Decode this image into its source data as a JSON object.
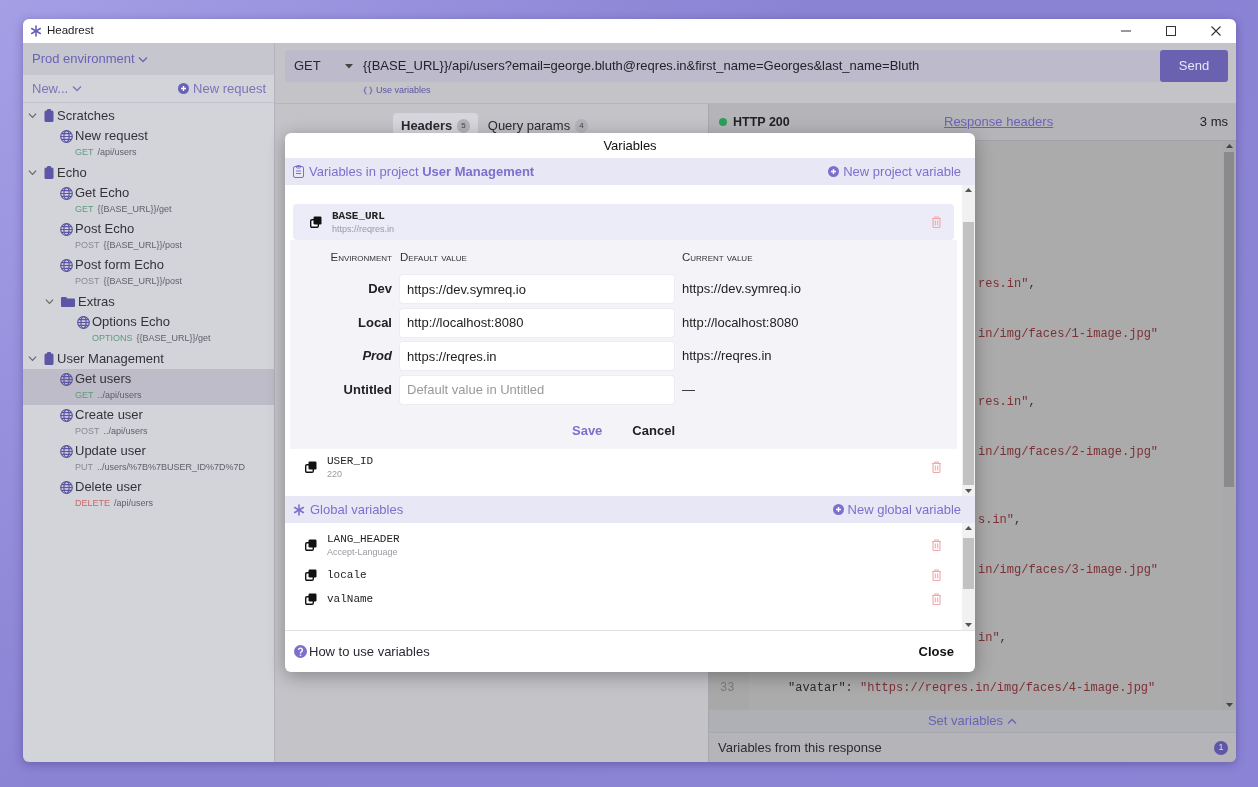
{
  "window": {
    "title": "Headrest"
  },
  "sidebar": {
    "environment": "Prod environment",
    "new_menu": "New...",
    "new_request": "New request",
    "tree": [
      {
        "kind": "project",
        "label": "Scratches",
        "expanded": true,
        "children": [
          {
            "kind": "request",
            "label": "New request",
            "method": "GET",
            "url": "/api/users",
            "color": "#5f9a7c",
            "selected": false
          }
        ]
      },
      {
        "kind": "project",
        "label": "Echo",
        "expanded": true,
        "children": [
          {
            "kind": "request",
            "label": "Get Echo",
            "method": "GET",
            "url": "{{BASE_URL}}/get",
            "color": "#5f9a7c",
            "selected": false
          },
          {
            "kind": "request",
            "label": "Post Echo",
            "method": "POST",
            "url": "{{BASE_URL}}/post",
            "color": "#8a8a93",
            "selected": false
          },
          {
            "kind": "request",
            "label": "Post form Echo",
            "method": "POST",
            "url": "{{BASE_URL}}/post",
            "color": "#8a8a93",
            "selected": false
          },
          {
            "kind": "folder",
            "label": "Extras",
            "expanded": true,
            "children": [
              {
                "kind": "request",
                "label": "Options Echo",
                "method": "OPTIONS",
                "url": "{{BASE_URL}}/get",
                "color": "#5f9a7c",
                "selected": false
              }
            ]
          }
        ]
      },
      {
        "kind": "project",
        "label": "User Management",
        "expanded": true,
        "children": [
          {
            "kind": "request",
            "label": "Get users",
            "method": "GET",
            "url": "../api/users",
            "color": "#5f9a7c",
            "selected": true
          },
          {
            "kind": "request",
            "label": "Create user",
            "method": "POST",
            "url": "../api/users",
            "color": "#8a8a93",
            "selected": false
          },
          {
            "kind": "request",
            "label": "Update user",
            "method": "PUT",
            "url": "../users/%7B%7BUSER_ID%7D%7D",
            "color": "#8a8a93",
            "selected": false
          },
          {
            "kind": "request",
            "label": "Delete user",
            "method": "DELETE",
            "url": "/api/users",
            "color": "#c96a6a",
            "selected": false
          }
        ]
      }
    ]
  },
  "request": {
    "method": "GET",
    "url": "{{BASE_URL}}/api/users?email=george.bluth@reqres.in&first_name=Georges&last_name=Bluth",
    "send": "Send",
    "use_variables": "Use variables",
    "tabs": [
      {
        "label": "Headers",
        "count": "5",
        "selected": true
      },
      {
        "label": "Query params",
        "count": "4",
        "selected": false
      }
    ]
  },
  "response": {
    "status": "HTTP 200",
    "headers_link": "Response headers",
    "time": "3 ms",
    "code_fragments": [
      {
        "string": "res.in\"",
        "rest": ","
      },
      {
        "string": "in/img/faces/1-image.jpg\""
      },
      {
        "string": "res.in\"",
        "rest": ","
      },
      {
        "string": "in/img/faces/2-image.jpg\""
      },
      {
        "string": "s.in\"",
        "rest": ","
      },
      {
        "string": "in/img/faces/3-image.jpg\""
      },
      {
        "string": "in\"",
        "rest": ","
      }
    ],
    "code_lines": [
      {
        "number": "33",
        "key": "\"avatar\"",
        "separator": ": ",
        "string": "\"https://reqres.in/img/faces/4-image.jpg\""
      }
    ],
    "set_variables": "Set variables",
    "from_response": "Variables from this response",
    "from_response_count": "1"
  },
  "modal": {
    "title": "Variables",
    "project_section": {
      "prefix": "Variables in project",
      "project": "User Management",
      "new": "New project variable",
      "variables": [
        {
          "name": "BASE_URL",
          "value": "https://reqres.in",
          "expanded": true,
          "editor": {
            "columns": [
              "Environment",
              "Default value",
              "Current value"
            ],
            "rows": [
              {
                "env": "Dev",
                "active": false,
                "default": "https://dev.symreq.io",
                "current": "https://dev.symreq.io"
              },
              {
                "env": "Local",
                "active": false,
                "default": "http://localhost:8080",
                "current": "http://localhost:8080"
              },
              {
                "env": "Prod",
                "active": true,
                "default": "https://reqres.in",
                "current": "https://reqres.in"
              },
              {
                "env": "Untitled",
                "active": false,
                "placeholder": "Default value in Untitled",
                "current": "—"
              }
            ],
            "save": "Save",
            "cancel": "Cancel"
          }
        },
        {
          "name": "USER_ID",
          "value": "220",
          "expanded": false
        }
      ]
    },
    "global_section": {
      "label": "Global variables",
      "new": "New global variable",
      "variables": [
        {
          "name": "LANG_HEADER",
          "value": "Accept-Language",
          "expanded": false
        },
        {
          "name": "locale",
          "expanded": false
        },
        {
          "name": "valName",
          "expanded": false
        }
      ]
    },
    "help_link": "How to use variables",
    "close": "Close"
  }
}
